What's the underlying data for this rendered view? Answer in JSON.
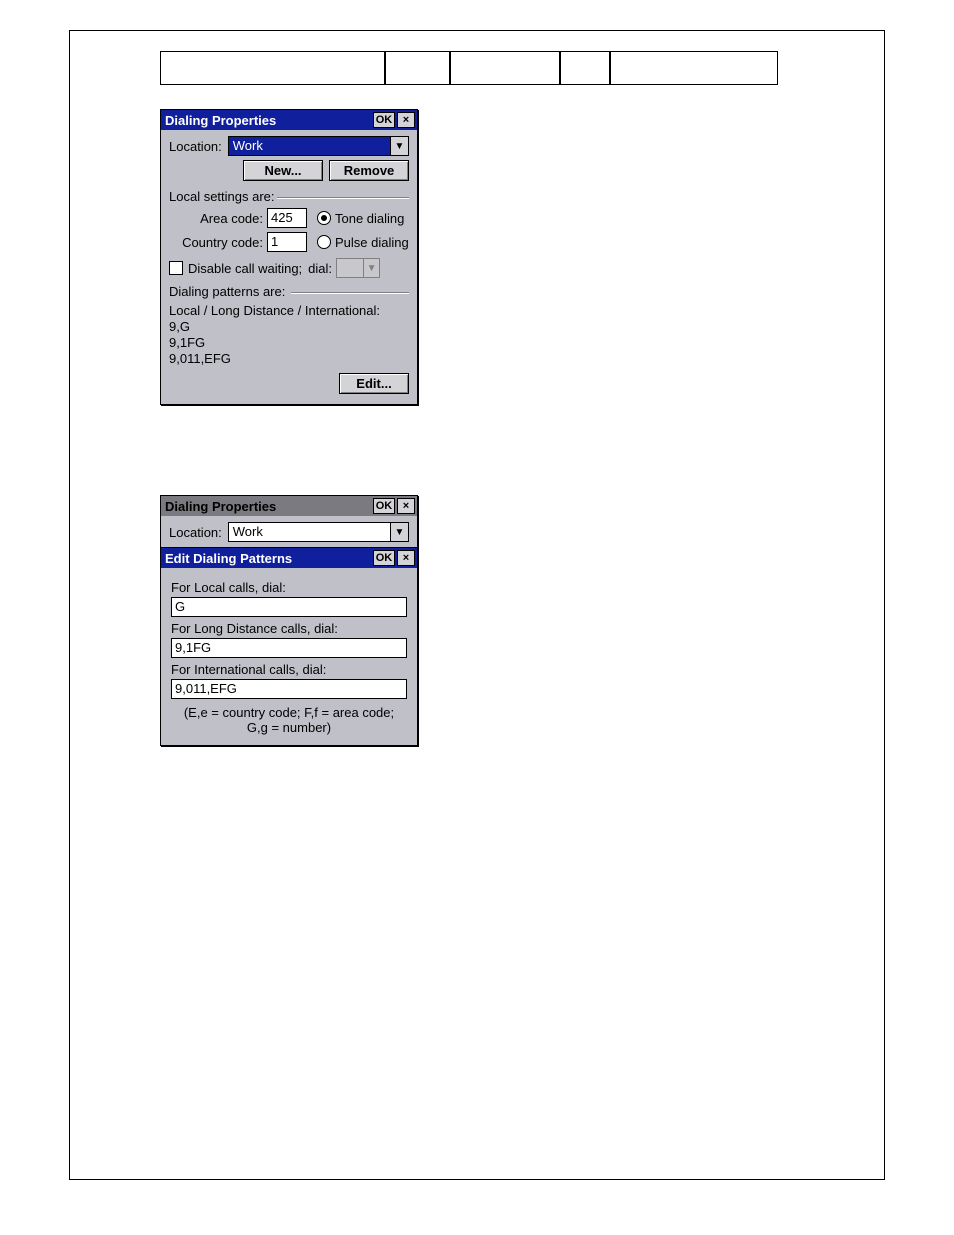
{
  "dialog1": {
    "title": "Dialing Properties",
    "ok": "OK",
    "close": "×",
    "location_label": "Location:",
    "location_value": "Work",
    "new_btn": "New...",
    "remove_btn": "Remove",
    "local_settings_label": "Local settings are:",
    "area_code_label": "Area code:",
    "area_code_value": "425",
    "country_code_label": "Country code:",
    "country_code_value": "1",
    "tone_label": "Tone dialing",
    "pulse_label": "Pulse dialing",
    "disable_cw_label": "Disable call waiting;",
    "dial_label": "dial:",
    "patterns_header": "Dialing patterns are:",
    "patterns_sub": "Local / Long Distance / International:",
    "pattern1": "9,G",
    "pattern2": "9,1FG",
    "pattern3": "9,011,EFG",
    "edit_btn": "Edit..."
  },
  "dialog2": {
    "back_title": "Dialing Properties",
    "back_location_label": "Location:",
    "back_location_value": "Work",
    "front_title": "Edit Dialing Patterns",
    "ok": "OK",
    "close": "×",
    "local_label": "For Local calls, dial:",
    "local_value": "G",
    "long_label": "For Long Distance calls, dial:",
    "long_value": "9,1FG",
    "intl_label": "For International calls, dial:",
    "intl_value": "9,011,EFG",
    "legend1": "(E,e = country code; F,f = area code;",
    "legend2": "G,g = number)"
  }
}
